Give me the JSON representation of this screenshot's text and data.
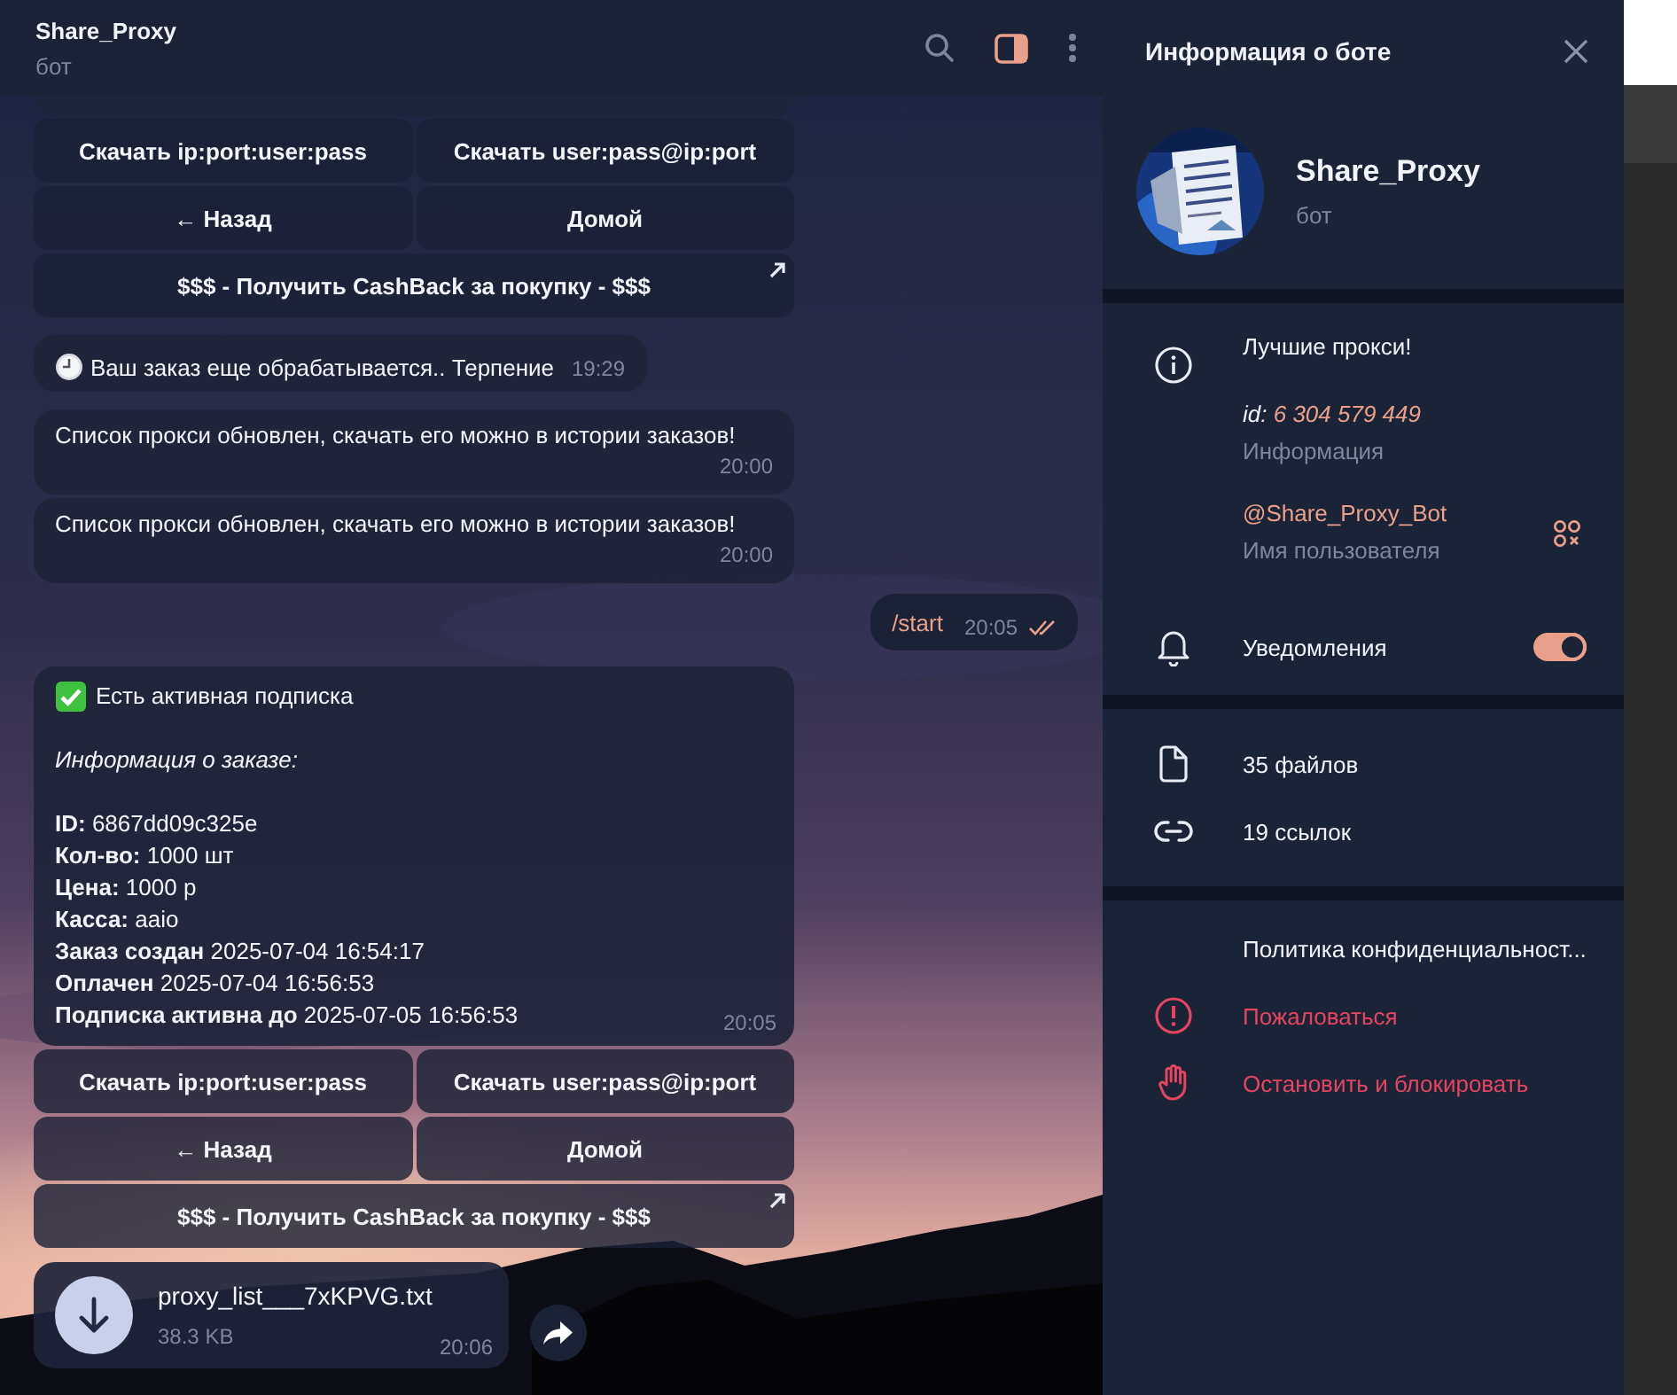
{
  "chat": {
    "title": "Share_Proxy",
    "subtitle": "бот",
    "panel_toggle": {
      "selected": true
    }
  },
  "messages": [
    {
      "kind": "partial"
    },
    {
      "kind": "keyboard",
      "rows": [
        [
          {
            "label": "Скачать ip:port:user:pass",
            "link": false
          },
          {
            "label": "Скачать user:pass@ip:port",
            "link": false
          }
        ],
        [
          {
            "label": "← Назад",
            "link": false
          },
          {
            "label": "Домой",
            "link": false
          }
        ],
        [
          {
            "label": "$$$ - Получить CashBack за покупку - $$$",
            "link": true
          }
        ]
      ]
    },
    {
      "kind": "status",
      "text": "Ваш заказ еще обрабатывается.. Терпение",
      "time": "19:29"
    },
    {
      "kind": "text",
      "text": "Список прокси обновлен, скачать его можно в истории заказов!",
      "time": "20:00"
    },
    {
      "kind": "text",
      "text": "Список прокси обновлен, скачать его можно в истории заказов!",
      "time": "20:00"
    },
    {
      "kind": "outgoing",
      "text": "/start",
      "time": "20:05",
      "read": true
    },
    {
      "kind": "order",
      "time": "20:05",
      "lines": [
        {
          "kind": "check",
          "text": "Есть активная подписка"
        },
        {
          "kind": "italic",
          "text": "Информация о заказе:"
        },
        {
          "kind": "field",
          "text": "**ID:** 6867dd09c325e"
        },
        {
          "kind": "field",
          "text": "**Кол-во:** 1000 шт"
        },
        {
          "kind": "field",
          "text": "**Цена:** 1000 р"
        },
        {
          "kind": "field",
          "text": "**Касса:** aaio"
        },
        {
          "kind": "field",
          "text": "**Заказ создан** 2025-07-04 16:54:17"
        },
        {
          "kind": "field",
          "text": "**Оплачен** 2025-07-04 16:56:53"
        },
        {
          "kind": "field",
          "text": "**Подписка активна до** 2025-07-05 16:56:53"
        }
      ]
    },
    {
      "kind": "keyboard",
      "rows": [
        [
          {
            "label": "Скачать ip:port:user:pass",
            "link": false
          },
          {
            "label": "Скачать user:pass@ip:port",
            "link": false
          }
        ],
        [
          {
            "label": "← Назад",
            "link": false
          },
          {
            "label": "Домой",
            "link": false
          }
        ],
        [
          {
            "label": "$$$ - Получить CashBack за покупку - $$$",
            "link": true
          }
        ]
      ]
    },
    {
      "kind": "file",
      "name": "proxy_list___7xKPVG.txt",
      "size": "38.3 KB",
      "time": "20:06"
    }
  ],
  "info_panel": {
    "title": "Информация о боте",
    "name": "Share_Proxy",
    "subtitle": "бот",
    "bio": "Лучшие прокси!",
    "id_label": "id:",
    "id_value": "6 304 579 449",
    "bio_caption": "Информация",
    "username": "@Share_Proxy_Bot",
    "username_caption": "Имя пользователя",
    "notifications": {
      "label": "Уведомления",
      "on": true
    },
    "media": [
      {
        "kind": "files",
        "label": "35 файлов"
      },
      {
        "kind": "links",
        "label": "19 ссылок"
      }
    ],
    "actions": [
      {
        "kind": "privacy",
        "label": "Политика конфиденциальност...",
        "danger": false
      },
      {
        "kind": "report",
        "label": "Пожаловаться",
        "danger": true
      },
      {
        "kind": "block",
        "label": "Остановить и блокировать",
        "danger": true
      }
    ]
  }
}
